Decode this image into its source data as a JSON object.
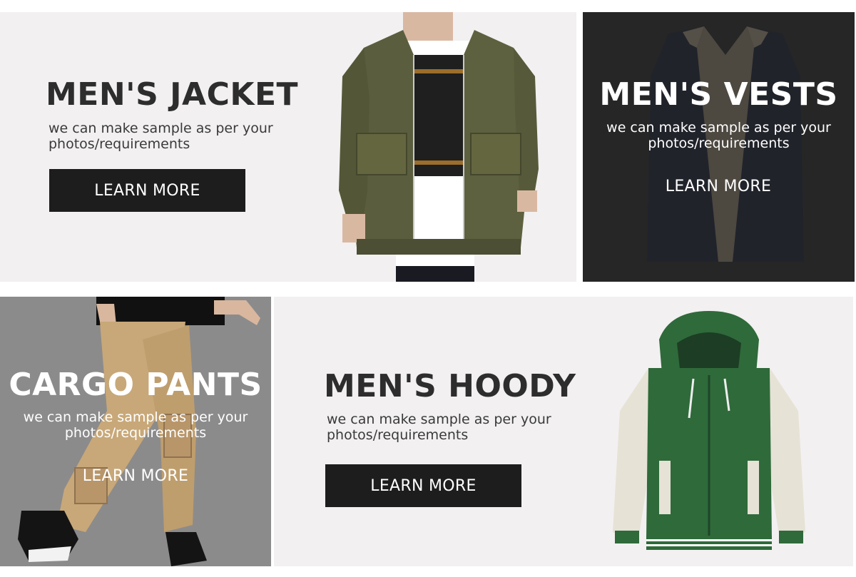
{
  "tiles": {
    "jacket": {
      "title": "MEN'S JACKET",
      "description": "we can make sample as per your photos/requirements",
      "button_label": "LEARN MORE"
    },
    "vests": {
      "title": "MEN'S VESTS",
      "description": "we can make sample as per your photos/requirements",
      "button_label": "LEARN MORE"
    },
    "cargo": {
      "title": "CARGO PANTS",
      "description": "we can make sample as per your photos/requirements",
      "button_label": "LEARN MORE"
    },
    "hoody": {
      "title": "MEN'S HOODY",
      "description": "we can make sample as per your photos/requirements",
      "button_label": "LEARN MORE"
    }
  },
  "colors": {
    "light_tile_bg": "#f2f0f1",
    "dark_tile_bg": "#262626",
    "gray_tile_bg": "#8c8b8c",
    "button_bg": "#1d1d1d",
    "heading_text": "#2d2d2d"
  },
  "images": {
    "jacket": "olive-bomber-jacket-photo",
    "vests": "navy-fleece-vest-photo",
    "cargo": "khaki-cargo-pants-photo",
    "hoody": "green-varsity-hoody-photo"
  }
}
